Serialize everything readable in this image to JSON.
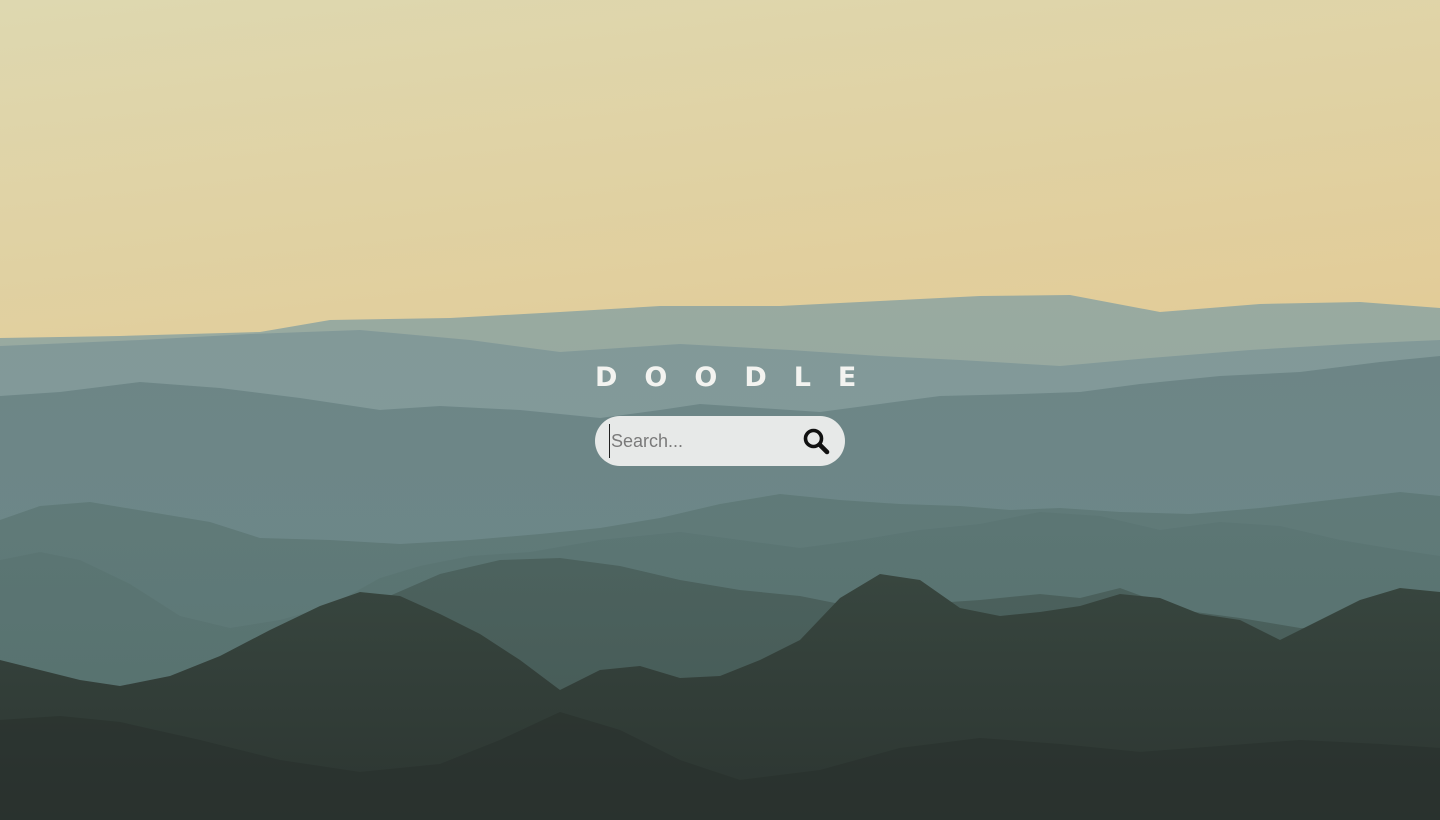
{
  "logo": {
    "text": "DOODLE"
  },
  "search": {
    "placeholder": "Search...",
    "value": "",
    "button_icon": "search-icon"
  },
  "colors": {
    "sky_top": "#e2dab0",
    "sky_bottom": "#e9c793",
    "haze": "#8fa6a3",
    "mountain_dark": "#2f3935",
    "search_bg": "#f2f2f0",
    "logo_text": "#f3f3f0"
  }
}
